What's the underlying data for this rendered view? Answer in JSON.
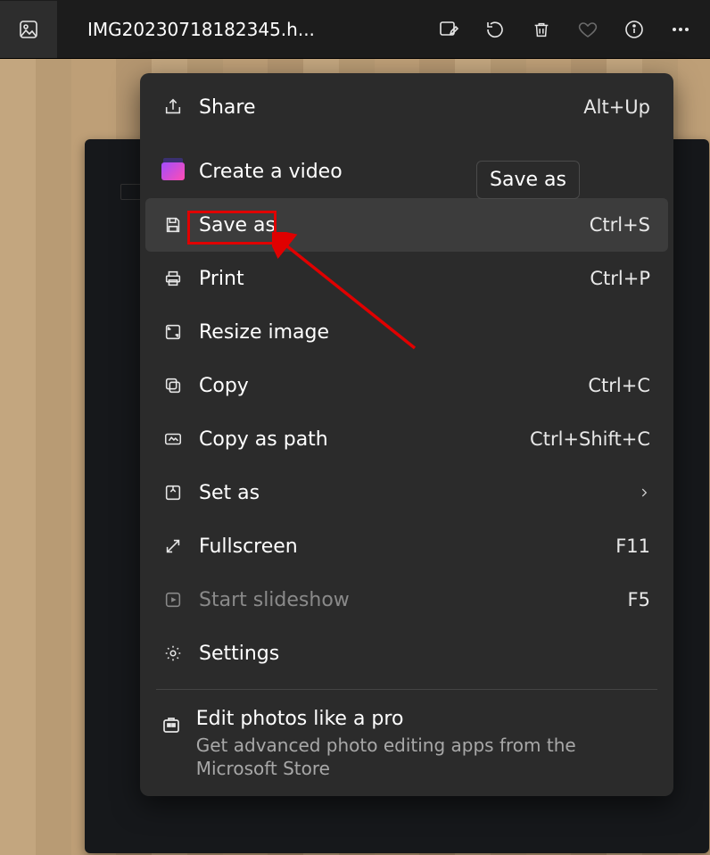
{
  "titlebar": {
    "filename": "IMG20230718182345.h..."
  },
  "tooltip": {
    "text": "Save as"
  },
  "menu": {
    "share": {
      "label": "Share",
      "shortcut": "Alt+Up"
    },
    "create_video": {
      "label": "Create a video"
    },
    "save_as": {
      "label": "Save as",
      "shortcut": "Ctrl+S"
    },
    "print": {
      "label": "Print",
      "shortcut": "Ctrl+P"
    },
    "resize": {
      "label": "Resize image"
    },
    "copy": {
      "label": "Copy",
      "shortcut": "Ctrl+C"
    },
    "copy_path": {
      "label": "Copy as path",
      "shortcut": "Ctrl+Shift+C"
    },
    "set_as": {
      "label": "Set as"
    },
    "fullscreen": {
      "label": "Fullscreen",
      "shortcut": "F11"
    },
    "slideshow": {
      "label": "Start slideshow",
      "shortcut": "F5"
    },
    "settings": {
      "label": "Settings"
    },
    "promo": {
      "title": "Edit photos like a pro",
      "subtitle": "Get advanced photo editing apps from the Microsoft Store"
    }
  }
}
